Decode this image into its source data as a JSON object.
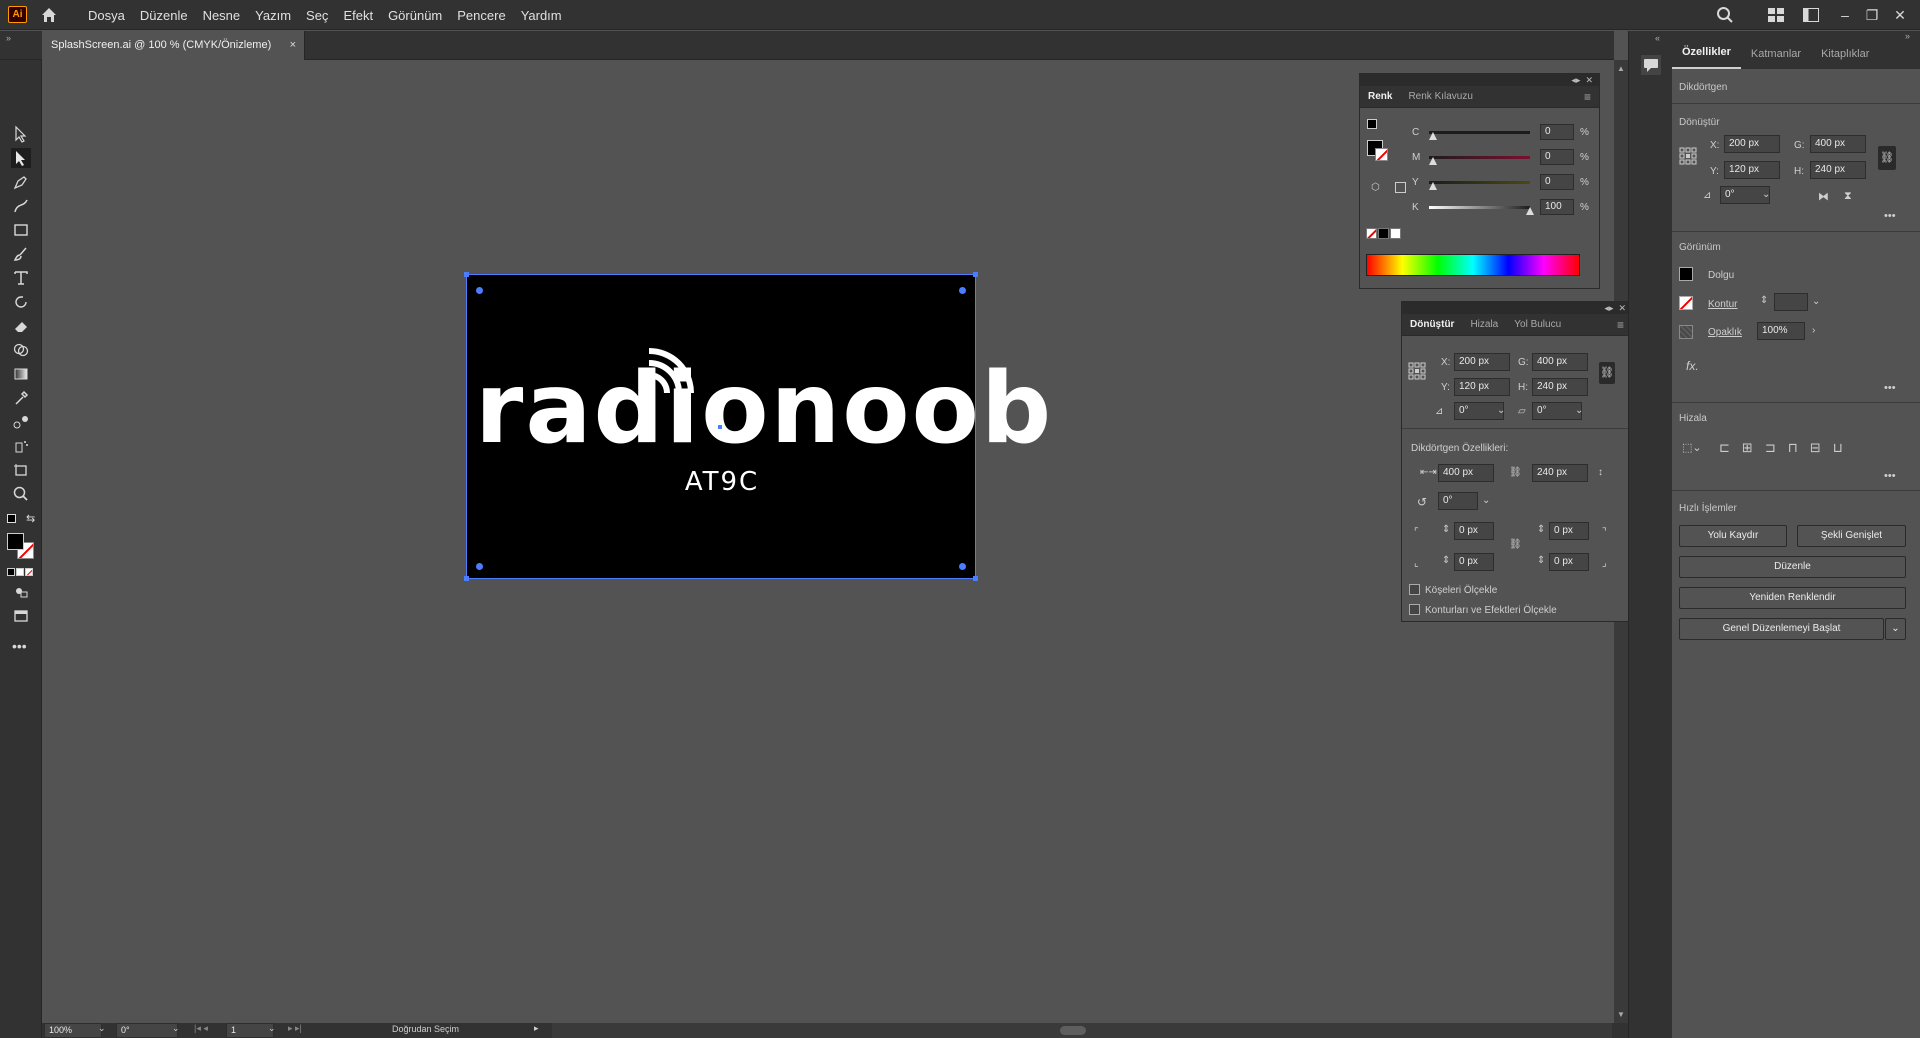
{
  "app": {
    "logo_text": "Ai"
  },
  "menu": [
    "Dosya",
    "Düzenle",
    "Nesne",
    "Yazım",
    "Seç",
    "Efekt",
    "Görünüm",
    "Pencere",
    "Yardım"
  ],
  "document_tab": {
    "title": "SplashScreen.ai @ 100 % (CMYK/Önizleme)",
    "close": "×"
  },
  "artboard": {
    "logo_word": "radionoob",
    "logo_sub": "AT9C"
  },
  "color_panel": {
    "tabs": [
      "Renk",
      "Renk Kılavuzu"
    ],
    "channels": [
      {
        "label": "C",
        "value": "0",
        "unit": "%"
      },
      {
        "label": "M",
        "value": "0",
        "unit": "%"
      },
      {
        "label": "Y",
        "value": "0",
        "unit": "%"
      },
      {
        "label": "K",
        "value": "100",
        "unit": "%"
      }
    ]
  },
  "transform_panel": {
    "tabs": [
      "Dönüştür",
      "Hizala",
      "Yol Bulucu"
    ],
    "x_label": "X:",
    "x": "200 px",
    "y_label": "Y:",
    "y": "120 px",
    "w_label": "G:",
    "w": "400 px",
    "h_label": "H:",
    "h": "240 px",
    "angle": "0°",
    "shear": "0°",
    "rect_props_title": "Dikdörtgen Özellikleri:",
    "rect_w": "400 px",
    "rect_h": "240 px",
    "rect_angle": "0°",
    "corners": [
      "0 px",
      "0 px",
      "0 px",
      "0 px"
    ],
    "scale_corners": "Köşeleri Ölçekle",
    "scale_strokes": "Konturları ve Efektleri Ölçekle"
  },
  "properties": {
    "tabs": [
      "Özellikler",
      "Katmanlar",
      "Kitaplıklar"
    ],
    "object_type": "Dikdörtgen",
    "transform_title": "Dönüştür",
    "x_label": "X:",
    "x": "200 px",
    "y_label": "Y:",
    "y": "120 px",
    "w_label": "G:",
    "w": "400 px",
    "h_label": "H:",
    "h": "240 px",
    "angle": "0°",
    "appearance_title": "Görünüm",
    "fill": "Dolgu",
    "stroke": "Kontur",
    "opacity_label": "Opaklık",
    "opacity": "100%",
    "fx": "fx.",
    "align_title": "Hizala",
    "quick_title": "Hızlı İşlemler",
    "btn_offset": "Yolu Kaydır",
    "btn_expand": "Şekli Genişlet",
    "btn_arrange": "Düzenle",
    "btn_recolor": "Yeniden Renklendir",
    "btn_global_edit": "Genel Düzenlemeyi Başlat"
  },
  "status": {
    "zoom": "100%",
    "rotation": "0°",
    "artboard_num": "1",
    "tool": "Doğrudan Seçim"
  },
  "colors": {
    "bg": "#535353",
    "chrome": "#323232",
    "selection": "#4a7dff",
    "artboard": "#000000"
  }
}
